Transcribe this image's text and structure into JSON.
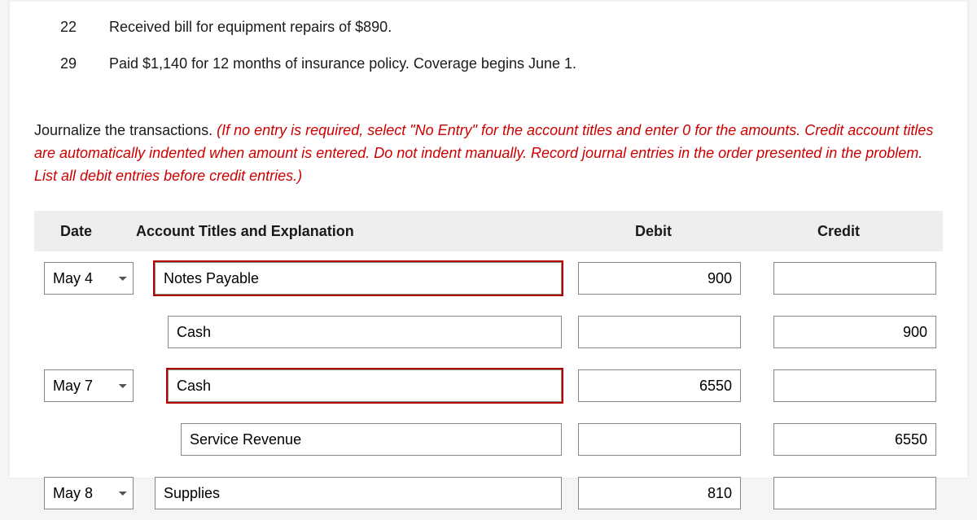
{
  "transactions": [
    {
      "day": "22",
      "desc": "Received bill for equipment repairs of $890."
    },
    {
      "day": "29",
      "desc": "Paid $1,140 for 12 months of insurance policy. Coverage begins June 1."
    }
  ],
  "instructions": {
    "lead": "Journalize the transactions. ",
    "red": "(If no entry is required, select \"No Entry\" for the account titles and enter 0 for the amounts. Credit account titles are automatically indented when amount is entered. Do not indent manually. Record journal entries in the order presented in the problem. List all debit entries before credit entries.)"
  },
  "headers": {
    "date": "Date",
    "account": "Account Titles and Explanation",
    "debit": "Debit",
    "credit": "Credit"
  },
  "rows": [
    {
      "date": "May 4",
      "account": "Notes Payable",
      "indent": 0,
      "highlight": true,
      "debit": "900",
      "credit": ""
    },
    {
      "date": "",
      "account": "Cash",
      "indent": 1,
      "highlight": false,
      "debit": "",
      "credit": "900"
    },
    {
      "date": "May 7",
      "account": "Cash",
      "indent": 1,
      "highlight": true,
      "debit": "6550",
      "credit": ""
    },
    {
      "date": "",
      "account": "Service Revenue",
      "indent": 2,
      "highlight": false,
      "debit": "",
      "credit": "6550"
    },
    {
      "date": "May 8",
      "account": "Supplies",
      "indent": 0,
      "highlight": false,
      "debit": "810",
      "credit": ""
    }
  ]
}
